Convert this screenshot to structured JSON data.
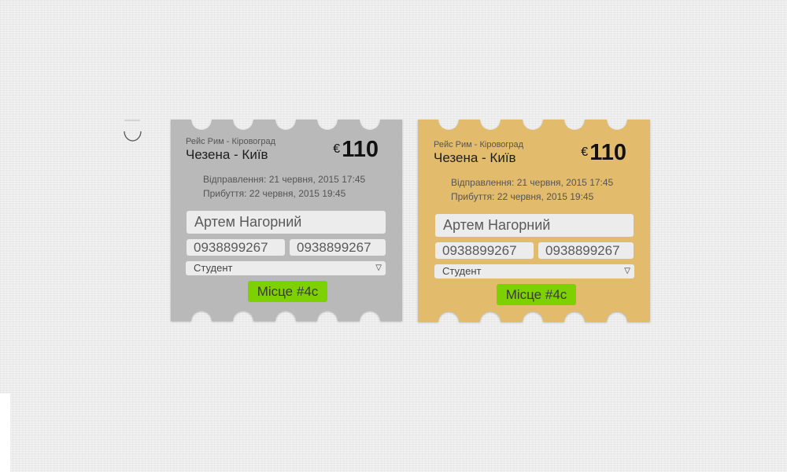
{
  "remove_icon": "remove-ticket-icon",
  "tickets": [
    {
      "color": "#b9b9b9",
      "route_small": "Рейс Рим - Кіровоград",
      "route_main": "Чезена - Київ",
      "currency": "€",
      "price": "110",
      "departure": "Відправлення: 21 червня, 2015 17:45",
      "arrival": "Прибуття: 22 червня, 2015 19:45",
      "name": "Артем Нагорний",
      "phone1": "0938899267",
      "phone2": "0938899267",
      "category": "Студент",
      "seat": "Місце #4с"
    },
    {
      "color": "#e3bb6c",
      "route_small": "Рейс Рим - Кіровоград",
      "route_main": "Чезена - Київ",
      "currency": "€",
      "price": "110",
      "departure": "Відправлення: 21 червня, 2015 17:45",
      "arrival": "Прибуття: 22 червня, 2015 19:45",
      "name": "Артем Нагорний",
      "phone1": "0938899267",
      "phone2": "0938899267",
      "category": "Студент",
      "seat": "Місце #4с"
    }
  ]
}
